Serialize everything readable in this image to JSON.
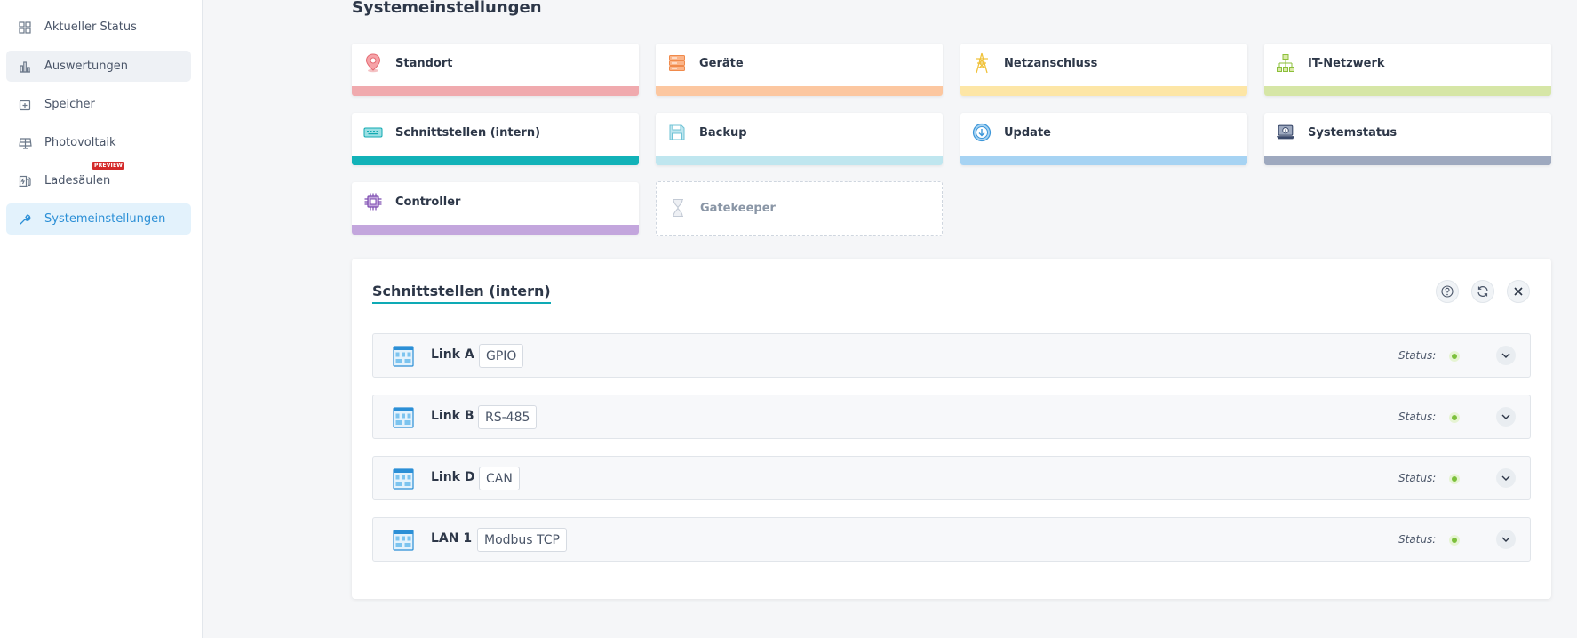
{
  "sidebar": {
    "items": [
      {
        "label": "Aktueller Status",
        "icon": "grid-icon"
      },
      {
        "label": "Auswertungen",
        "icon": "bar-chart-icon"
      },
      {
        "label": "Speicher",
        "icon": "battery-icon"
      },
      {
        "label": "Photovoltaik",
        "icon": "solar-panel-icon"
      },
      {
        "label": "Ladesäulen",
        "icon": "charging-station-icon",
        "badge": "PREVIEW"
      },
      {
        "label": "Systemeinstellungen",
        "icon": "wrench-icon"
      }
    ],
    "active_index": 5
  },
  "page": {
    "title": "Systemeinstellungen"
  },
  "tiles": [
    {
      "label": "Standort",
      "icon": "location-pin-icon",
      "bar_color": "#f0aaae"
    },
    {
      "label": "Geräte",
      "icon": "server-icon",
      "bar_color": "#fcc7a0"
    },
    {
      "label": "Netzanschluss",
      "icon": "power-pylon-icon",
      "bar_color": "#fde6a6"
    },
    {
      "label": "IT-Netzwerk",
      "icon": "network-tree-icon",
      "bar_color": "#d6e6a6"
    },
    {
      "label": "Schnittstellen (intern)",
      "icon": "interface-port-icon",
      "bar_color": "#12b2b8"
    },
    {
      "label": "Backup",
      "icon": "floppy-disk-icon",
      "bar_color": "#bfe6ef"
    },
    {
      "label": "Update",
      "icon": "download-circle-icon",
      "bar_color": "#a6d3f3"
    },
    {
      "label": "Systemstatus",
      "icon": "laptop-info-icon",
      "bar_color": "#9ea9bf"
    },
    {
      "label": "Controller",
      "icon": "chip-icon",
      "bar_color": "#c3a6dd"
    },
    {
      "label": "Gatekeeper",
      "icon": "hourglass-icon",
      "disabled": true
    }
  ],
  "panel": {
    "title": "Schnittstellen (intern)",
    "status_label": "Status:",
    "rows": [
      {
        "name": "Link A",
        "tag": "GPIO",
        "status_color": "#7cc03b"
      },
      {
        "name": "Link B",
        "tag": "RS-485",
        "status_color": "#7cc03b"
      },
      {
        "name": "Link D",
        "tag": "CAN",
        "status_color": "#7cc03b"
      },
      {
        "name": "LAN 1",
        "tag": "Modbus TCP",
        "status_color": "#7cc03b"
      }
    ]
  }
}
